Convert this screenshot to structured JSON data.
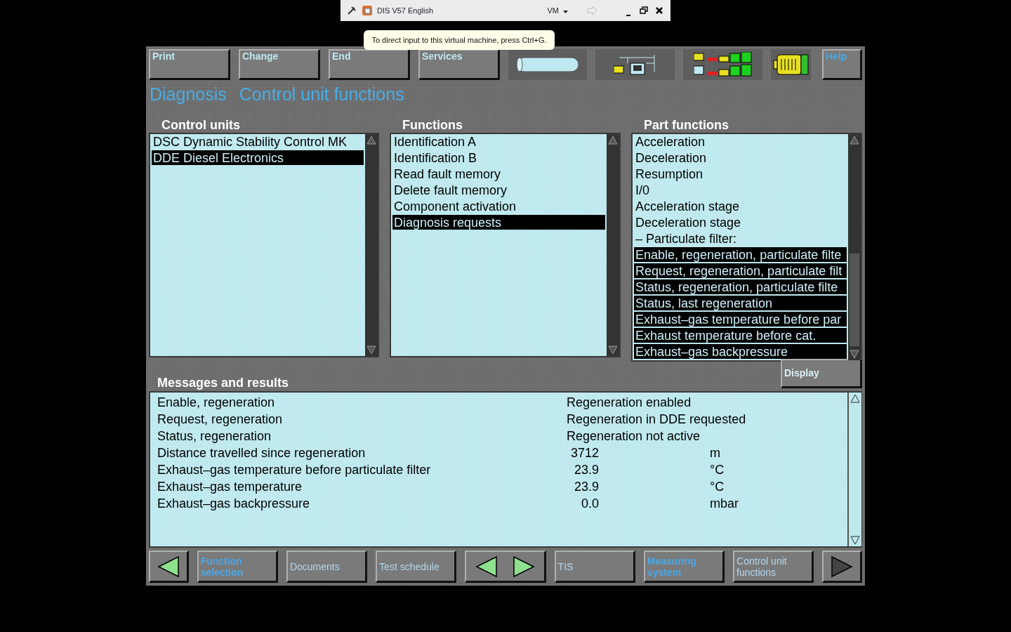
{
  "vm_bar": {
    "title": "DIS V57 English",
    "menu": "VM",
    "tooltip": "To direct input to this virtual machine, press Ctrl+G."
  },
  "toolbar": {
    "buttons": [
      {
        "label": "Print",
        "disabled": false
      },
      {
        "label": "Change",
        "disabled": false
      },
      {
        "label": "End",
        "disabled": false
      },
      {
        "label": "Services",
        "disabled": false
      }
    ],
    "help": "Help"
  },
  "title": {
    "section": "Diagnosis",
    "page": "Control unit functions"
  },
  "control_units": {
    "heading": "Control units",
    "items": [
      {
        "label": "DSC Dynamic Stability Control MK",
        "selected": false
      },
      {
        "label": "DDE Diesel Electronics",
        "selected": true
      }
    ]
  },
  "functions": {
    "heading": "Functions",
    "items": [
      {
        "label": "Identification A",
        "selected": false
      },
      {
        "label": "Identification B",
        "selected": false
      },
      {
        "label": "Read fault memory",
        "selected": false
      },
      {
        "label": "Delete fault memory",
        "selected": false
      },
      {
        "label": "Component activation",
        "selected": false
      },
      {
        "label": "Diagnosis requests",
        "selected": true
      }
    ]
  },
  "part_functions": {
    "heading": "Part functions",
    "items": [
      {
        "label": "Acceleration",
        "selected": false
      },
      {
        "label": "Deceleration",
        "selected": false
      },
      {
        "label": "Resumption",
        "selected": false
      },
      {
        "label": "I/0",
        "selected": false
      },
      {
        "label": "Acceleration stage",
        "selected": false
      },
      {
        "label": "Deceleration stage",
        "selected": false
      },
      {
        "label": "– Particulate filter:",
        "selected": false
      },
      {
        "label": "Enable, regeneration, particulate filte",
        "selected": true
      },
      {
        "label": "Request, regeneration, particulate filt",
        "selected": true
      },
      {
        "label": "Status, regeneration, particulate filte",
        "selected": true
      },
      {
        "label": "Status, last regeneration",
        "selected": true
      },
      {
        "label": "Exhaust–gas temperature before par",
        "selected": true
      },
      {
        "label": "Exhaust temperature before cat.",
        "selected": true
      },
      {
        "label": "Exhaust–gas backpressure",
        "selected": true
      }
    ]
  },
  "messages": {
    "heading": "Messages and results",
    "display_button": "Display",
    "rows": [
      {
        "kind": "status",
        "name": "Enable, regeneration",
        "value": "Regeneration enabled"
      },
      {
        "kind": "status",
        "name": "Request, regeneration",
        "value": "Regeneration in DDE requested"
      },
      {
        "kind": "status",
        "name": "Status, regeneration",
        "value": "Regeneration not active"
      },
      {
        "kind": "measurement",
        "name": "Distance travelled since regeneration",
        "value": "3712",
        "unit": "m"
      },
      {
        "kind": "measurement",
        "name": "Exhaust–gas temperature before particulate filter",
        "value": "23.9",
        "unit": "°C"
      },
      {
        "kind": "measurement",
        "name": "Exhaust–gas temperature",
        "value": "23.9",
        "unit": "°C"
      },
      {
        "kind": "measurement",
        "name": "Exhaust–gas backpressure",
        "value": "0.0",
        "unit": "mbar"
      }
    ]
  },
  "bottom_bar": [
    {
      "kind": "arrow-left",
      "disabled": false
    },
    {
      "kind": "button",
      "label": "Function selection",
      "disabled": false
    },
    {
      "kind": "button",
      "label": "Documents",
      "disabled": true
    },
    {
      "kind": "button",
      "label": "Test schedule",
      "disabled": true
    },
    {
      "kind": "arrows",
      "disabled": false
    },
    {
      "kind": "button",
      "label": "TIS",
      "disabled": true
    },
    {
      "kind": "button",
      "label": "Measuring system",
      "disabled": false
    },
    {
      "kind": "button",
      "label": "Control unit functions",
      "disabled": true
    },
    {
      "kind": "arrow-right",
      "disabled": true
    }
  ]
}
